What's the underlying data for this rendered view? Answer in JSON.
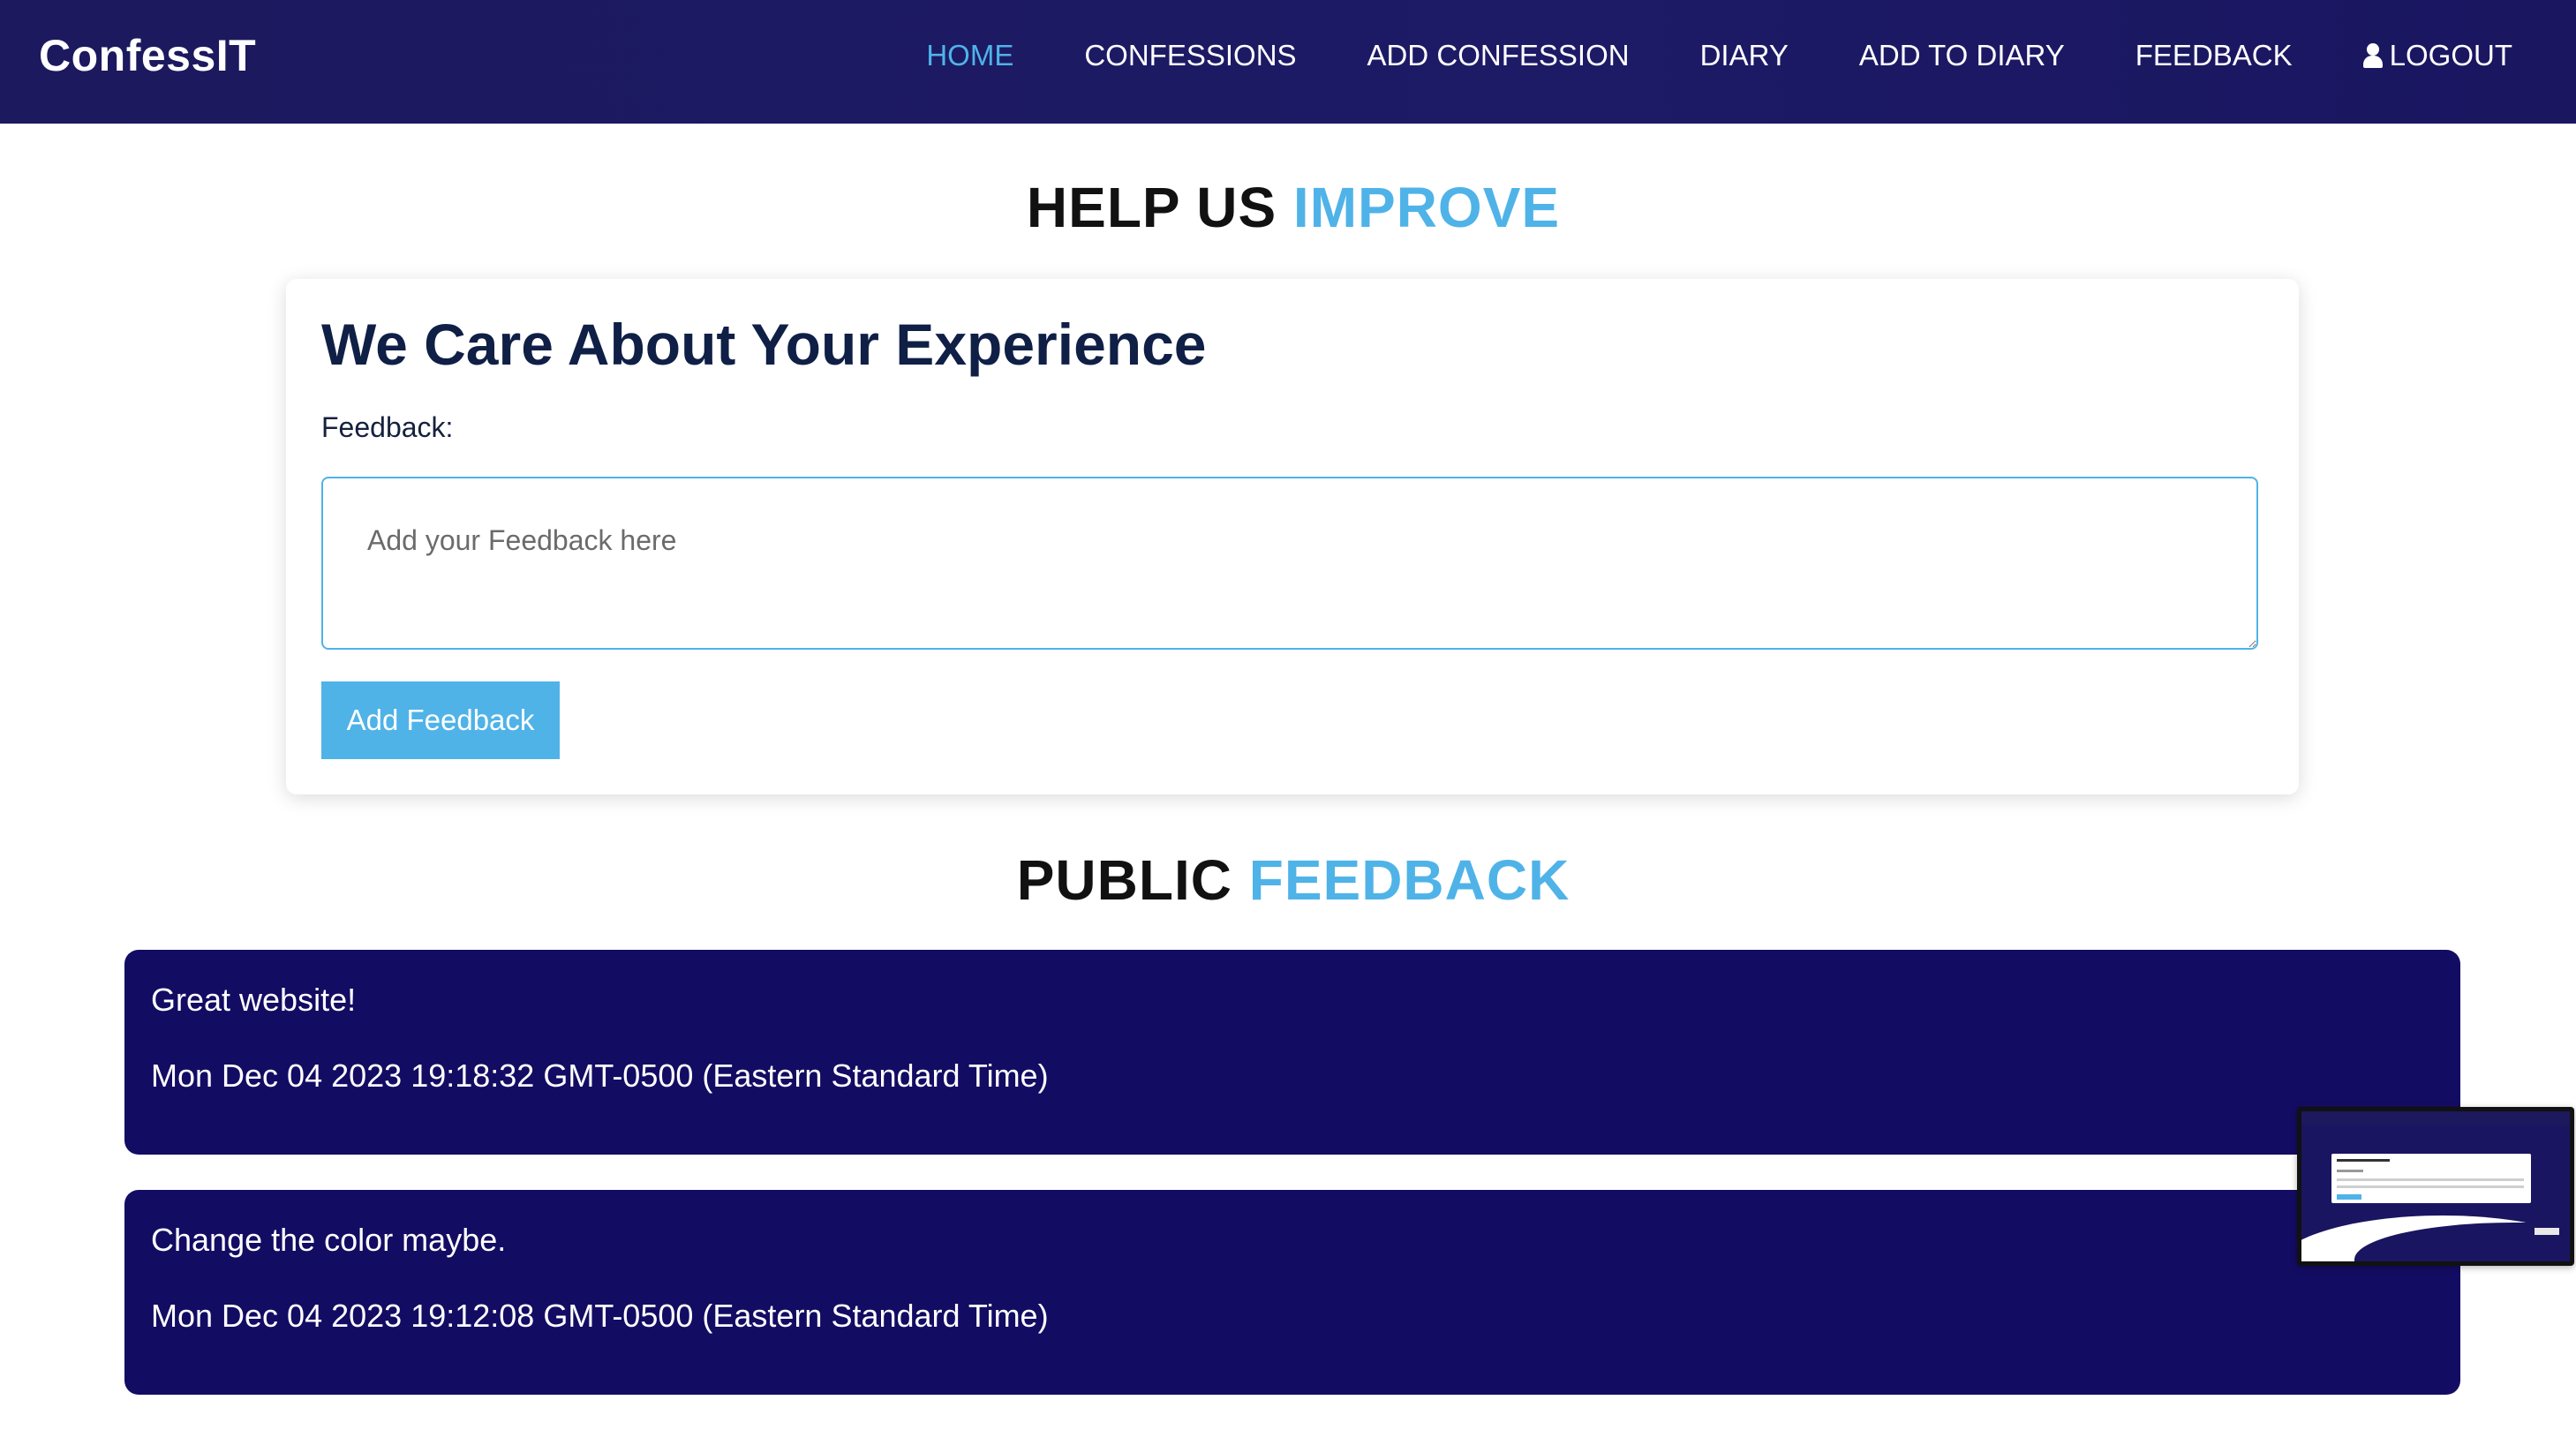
{
  "app": {
    "brand": "ConfessIT"
  },
  "nav": {
    "items": [
      {
        "label": "HOME",
        "active": true
      },
      {
        "label": "CONFESSIONS"
      },
      {
        "label": "ADD CONFESSION"
      },
      {
        "label": "DIARY"
      },
      {
        "label": "ADD TO DIARY"
      },
      {
        "label": "FEEDBACK"
      },
      {
        "label": "LOGOUT",
        "icon": "user-icon"
      }
    ]
  },
  "improve_section": {
    "title_prefix": "HELP US",
    "title_accent": "IMPROVE"
  },
  "feedback_form": {
    "heading": "We Care About Your Experience",
    "label": "Feedback:",
    "placeholder": "Add your Feedback here",
    "value": "",
    "submit_label": "Add Feedback"
  },
  "public_section": {
    "title_prefix": "PUBLIC",
    "title_accent": "FEEDBACK"
  },
  "feedback_items": [
    {
      "text": "Great website!",
      "date": "Mon Dec 04 2023 19:18:32 GMT-0500 (Eastern Standard Time)"
    },
    {
      "text": "Change the color maybe.",
      "date": "Mon Dec 04 2023 19:12:08 GMT-0500 (Eastern Standard Time)"
    }
  ],
  "colors": {
    "nav_bg": "#1c195e",
    "accent": "#4fb3e8",
    "card_dark": "#130c63",
    "heading_dark": "#0f1f46"
  }
}
